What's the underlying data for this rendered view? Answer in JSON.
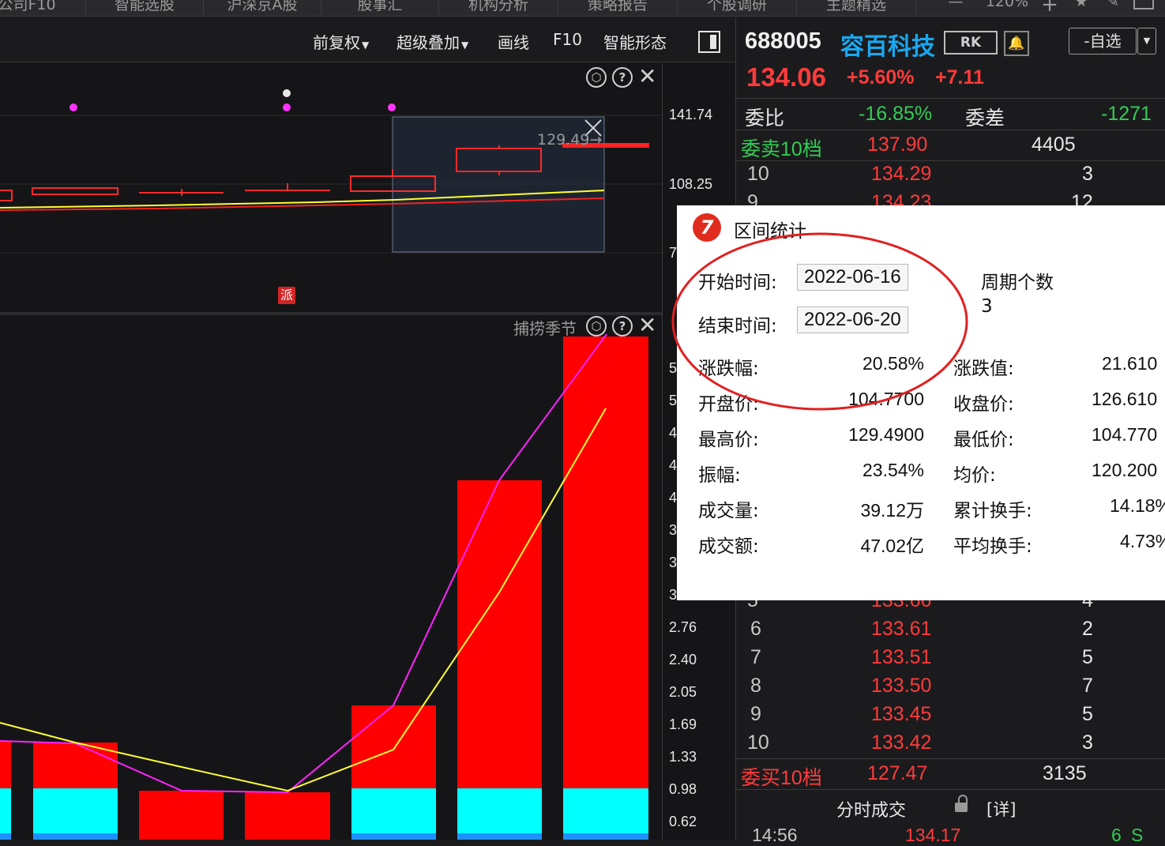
{
  "tabs": [
    "公司F10",
    "智能选股",
    "沪深京A股",
    "股事汇",
    "机构分析",
    "策略报告",
    "个股调研",
    "主题精选"
  ],
  "tab_controls": {
    "minus": "—",
    "zoom": "120%",
    "plus": "+",
    "star": "★",
    "edit": "✎"
  },
  "toolbar": {
    "fuquan": "前复权",
    "overlay": "超级叠加",
    "draw": "画线",
    "f10": "F10",
    "pattern": "智能形态"
  },
  "stock": {
    "code": "688005",
    "name": "容百科技",
    "rk_label": "RK",
    "watch_label": "-自选",
    "price": "134.06",
    "change_pct": "+5.60%",
    "change": "+7.11"
  },
  "orderbook": {
    "weibi_label": "委比",
    "weibi_value": "-16.85%",
    "weicha_label": "委差",
    "weicha_value": "-1271",
    "sell10_label": "委卖10档",
    "sell10_price": "137.90",
    "sell10_vol": "4405",
    "sell_rows": [
      {
        "level": "10",
        "price": "134.29",
        "vol": "3"
      },
      {
        "level": "9",
        "price": "134.23",
        "vol": "12"
      }
    ],
    "buy_rows": [
      {
        "level": "5",
        "price": "133.66",
        "vol": "4"
      },
      {
        "level": "6",
        "price": "133.61",
        "vol": "2"
      },
      {
        "level": "7",
        "price": "133.51",
        "vol": "5"
      },
      {
        "level": "8",
        "price": "133.50",
        "vol": "7"
      },
      {
        "level": "9",
        "price": "133.45",
        "vol": "5"
      },
      {
        "level": "10",
        "price": "133.42",
        "vol": "3"
      }
    ],
    "buy10_label": "委买10档",
    "buy10_price": "127.47",
    "buy10_vol": "3135",
    "tick_label": "分时成交",
    "detail_label": "[详]",
    "last_trade": {
      "time": "14:56",
      "price": "134.17",
      "vol": "6",
      "side": "S"
    }
  },
  "kline": {
    "price_ticks": [
      "141.74",
      "108.25",
      "7"
    ],
    "marker_label": "129.49→",
    "pai_label": "派"
  },
  "volume_panel": {
    "title": "捕捞季节",
    "ticks": [
      "5",
      "5",
      "4",
      "4",
      "4",
      "3",
      "3",
      "3",
      "2.76",
      "2.40",
      "2.05",
      "1.69",
      "1.33",
      "0.98",
      "0.62"
    ]
  },
  "dialog": {
    "title": "区间统计",
    "start_label": "开始时间:",
    "start_value": "2022-06-16",
    "end_label": "结束时间:",
    "end_value": "2022-06-20",
    "period_label": "周期个数",
    "period_value": "3",
    "rows": [
      {
        "l1": "涨跌幅:",
        "v1": "20.58%",
        "l2": "涨跌值:",
        "v2": "21.610"
      },
      {
        "l1": "开盘价:",
        "v1": "104.7700",
        "l2": "收盘价:",
        "v2": "126.610"
      },
      {
        "l1": "最高价:",
        "v1": "129.4900",
        "l2": "最低价:",
        "v2": "104.770"
      },
      {
        "l1": "振幅:",
        "v1": "23.54%",
        "l2": "均价:",
        "v2": "120.200"
      },
      {
        "l1": "成交量:",
        "v1": "39.12万",
        "l2": "累计换手:",
        "v2": "14.18%"
      },
      {
        "l1": "成交额:",
        "v1": "47.02亿",
        "l2": "平均换手:",
        "v2": "4.73%"
      }
    ]
  },
  "colors": {
    "up": "#ff3b3b",
    "down": "#33cc55",
    "cyan": "#00ffff",
    "magenta": "#ff22ff",
    "yellow": "#ffff00",
    "circle": "#e02020"
  }
}
